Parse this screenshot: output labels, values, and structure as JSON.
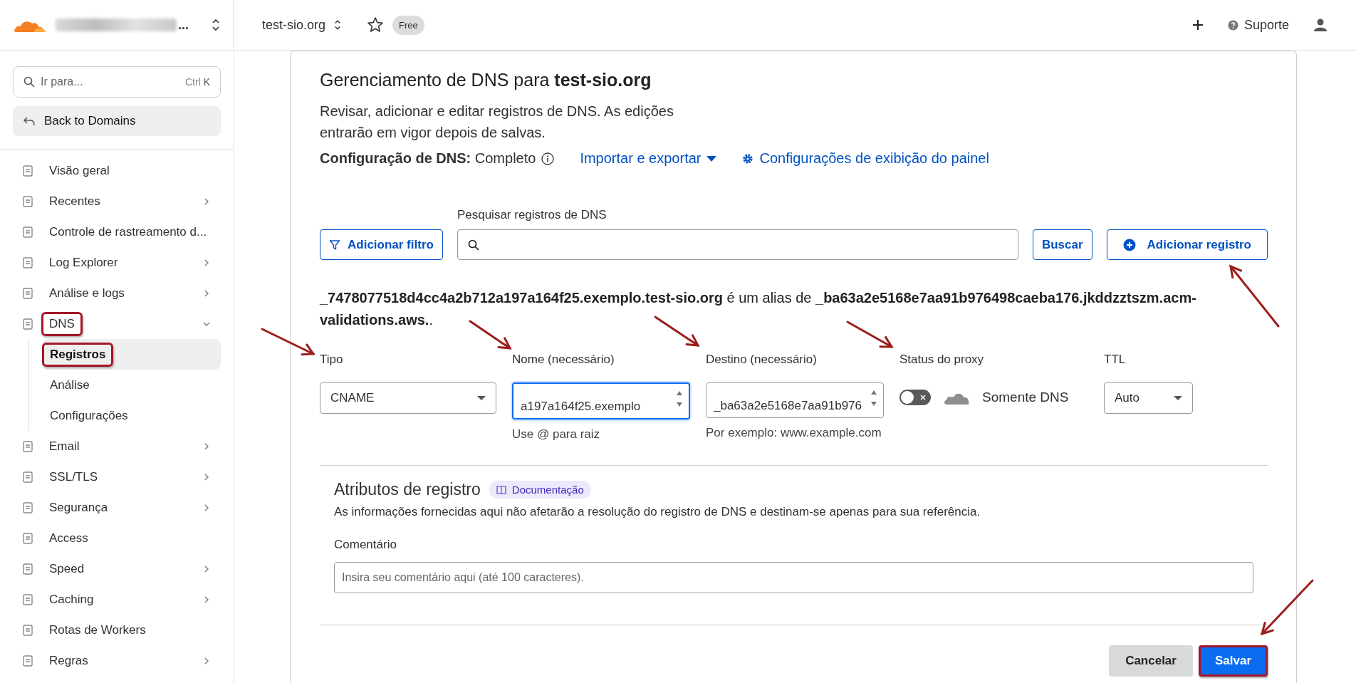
{
  "topbar": {
    "account_ellipsis": "...",
    "domain": "test-sio.org",
    "plan_badge": "Free",
    "support": "Suporte"
  },
  "sidebar": {
    "search": {
      "placeholder": "Ir para...",
      "shortcut_mod": "Ctrl",
      "shortcut_key": "K"
    },
    "back": "Back to Domains",
    "items": [
      {
        "label": "Visão geral",
        "expandable": false,
        "highlighted": false
      },
      {
        "label": "Recentes",
        "expandable": true,
        "expanded": false,
        "highlighted": false
      },
      {
        "label": "Controle de rastreamento d...",
        "expandable": false,
        "highlighted": false
      },
      {
        "label": "Log Explorer",
        "expandable": true,
        "expanded": false,
        "highlighted": false
      },
      {
        "label": "Análise e logs",
        "expandable": true,
        "expanded": false,
        "highlighted": false
      },
      {
        "label": "DNS",
        "expandable": true,
        "expanded": true,
        "highlighted": true,
        "children": [
          {
            "label": "Registros",
            "selected": true,
            "highlighted": true
          },
          {
            "label": "Análise",
            "selected": false,
            "highlighted": false
          },
          {
            "label": "Configurações",
            "selected": false,
            "highlighted": false
          }
        ]
      },
      {
        "label": "Email",
        "expandable": true,
        "expanded": false,
        "highlighted": false
      },
      {
        "label": "SSL/TLS",
        "expandable": true,
        "expanded": false,
        "highlighted": false
      },
      {
        "label": "Segurança",
        "expandable": true,
        "expanded": false,
        "highlighted": false
      },
      {
        "label": "Access",
        "expandable": false,
        "highlighted": false
      },
      {
        "label": "Speed",
        "expandable": true,
        "expanded": false,
        "highlighted": false
      },
      {
        "label": "Caching",
        "expandable": true,
        "expanded": false,
        "highlighted": false
      },
      {
        "label": "Rotas de Workers",
        "expandable": false,
        "highlighted": false
      },
      {
        "label": "Regras",
        "expandable": true,
        "expanded": false,
        "highlighted": false
      }
    ]
  },
  "main": {
    "title": "Gerenciamento de DNS para **test-sio.org**",
    "description": "Revisar, adicionar e editar registros de DNS. As edições entrarão em vigor depois de salvas.",
    "config_label": "Configuração de DNS:",
    "config_value": "Completo",
    "import_export": "Importar e exportar",
    "display_settings": "Configurações de exibição do painel",
    "add_filter": "Adicionar filtro",
    "search_label": "Pesquisar registros de DNS",
    "search_button": "Buscar",
    "add_record": "Adicionar registro",
    "alias_sentence": "**_7478077518d4cc4a2b712a197a164f25.exemplo.test-sio.org** é um alias de **_ba63a2e5168e7aa91b976498caeba176.jkddzztszm.acm-validations.aws.**.",
    "form": {
      "type_label": "Tipo",
      "type_value": "CNAME",
      "name_label": "Nome (necessário)",
      "name_value": "a197a164f25.exemplo",
      "name_hint": "Use @ para raiz",
      "target_label": "Destino (necessário)",
      "target_value": "_ba63a2e5168e7aa91b976",
      "target_hint": "Por exemplo: www.example.com",
      "proxy_label": "Status do proxy",
      "proxy_on": false,
      "proxy_text": "Somente DNS",
      "ttl_label": "TTL",
      "ttl_value": "Auto"
    },
    "attributes": {
      "title": "Atributos de registro",
      "doc_badge": "Documentação",
      "description": "As informações fornecidas aqui não afetarão a resolução do registro de DNS e destinam-se apenas para sua referência.",
      "comment_label": "Comentário",
      "comment_placeholder": "Insira seu comentário aqui (até 100 caracteres)."
    },
    "buttons": [
      {
        "label": "Cancelar",
        "kind": "secondary",
        "highlighted": false
      },
      {
        "label": "Salvar",
        "kind": "primary",
        "highlighted": true
      }
    ]
  }
}
